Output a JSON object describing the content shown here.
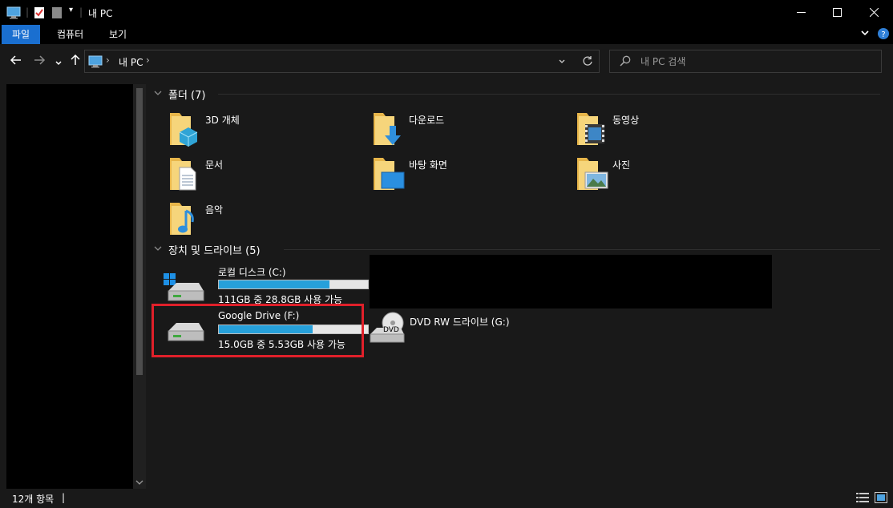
{
  "window": {
    "title": "내 PC"
  },
  "ribbon": {
    "tabs": [
      {
        "label": "파일",
        "active": true
      },
      {
        "label": "컴퓨터",
        "active": false
      },
      {
        "label": "보기",
        "active": false
      }
    ]
  },
  "address": {
    "location": "내 PC",
    "separator": "›"
  },
  "search": {
    "placeholder": "내 PC 검색"
  },
  "folders_group": {
    "header": "폴더 (7)",
    "items": [
      {
        "label": "3D 개체",
        "icon": "3d-objects-icon"
      },
      {
        "label": "다운로드",
        "icon": "downloads-icon"
      },
      {
        "label": "동영상",
        "icon": "videos-icon"
      },
      {
        "label": "문서",
        "icon": "documents-icon"
      },
      {
        "label": "바탕 화면",
        "icon": "desktop-icon"
      },
      {
        "label": "사진",
        "icon": "pictures-icon"
      },
      {
        "label": "음악",
        "icon": "music-icon"
      }
    ]
  },
  "drives_group": {
    "header": "장치 및 드라이브 (5)",
    "drives": [
      {
        "label": "로컬 디스크 (C:)",
        "usage": "111GB 중 28.8GB 사용 가능",
        "used_fraction": 0.74,
        "icon": "windows-drive-icon"
      },
      {
        "label": "Google Drive (F:)",
        "usage": "15.0GB 중 5.53GB 사용 가능",
        "used_fraction": 0.63,
        "icon": "drive-icon"
      },
      {
        "label": "DVD RW 드라이브 (G:)",
        "icon": "dvd-drive-icon",
        "badge": "DVD"
      }
    ]
  },
  "status": {
    "item_count": "12개 항목",
    "separator": "|"
  },
  "colors": {
    "accent": "#1a6fd0",
    "progress": "#26a0da",
    "highlight": "#e0202a",
    "folder": "#f2c45a"
  }
}
